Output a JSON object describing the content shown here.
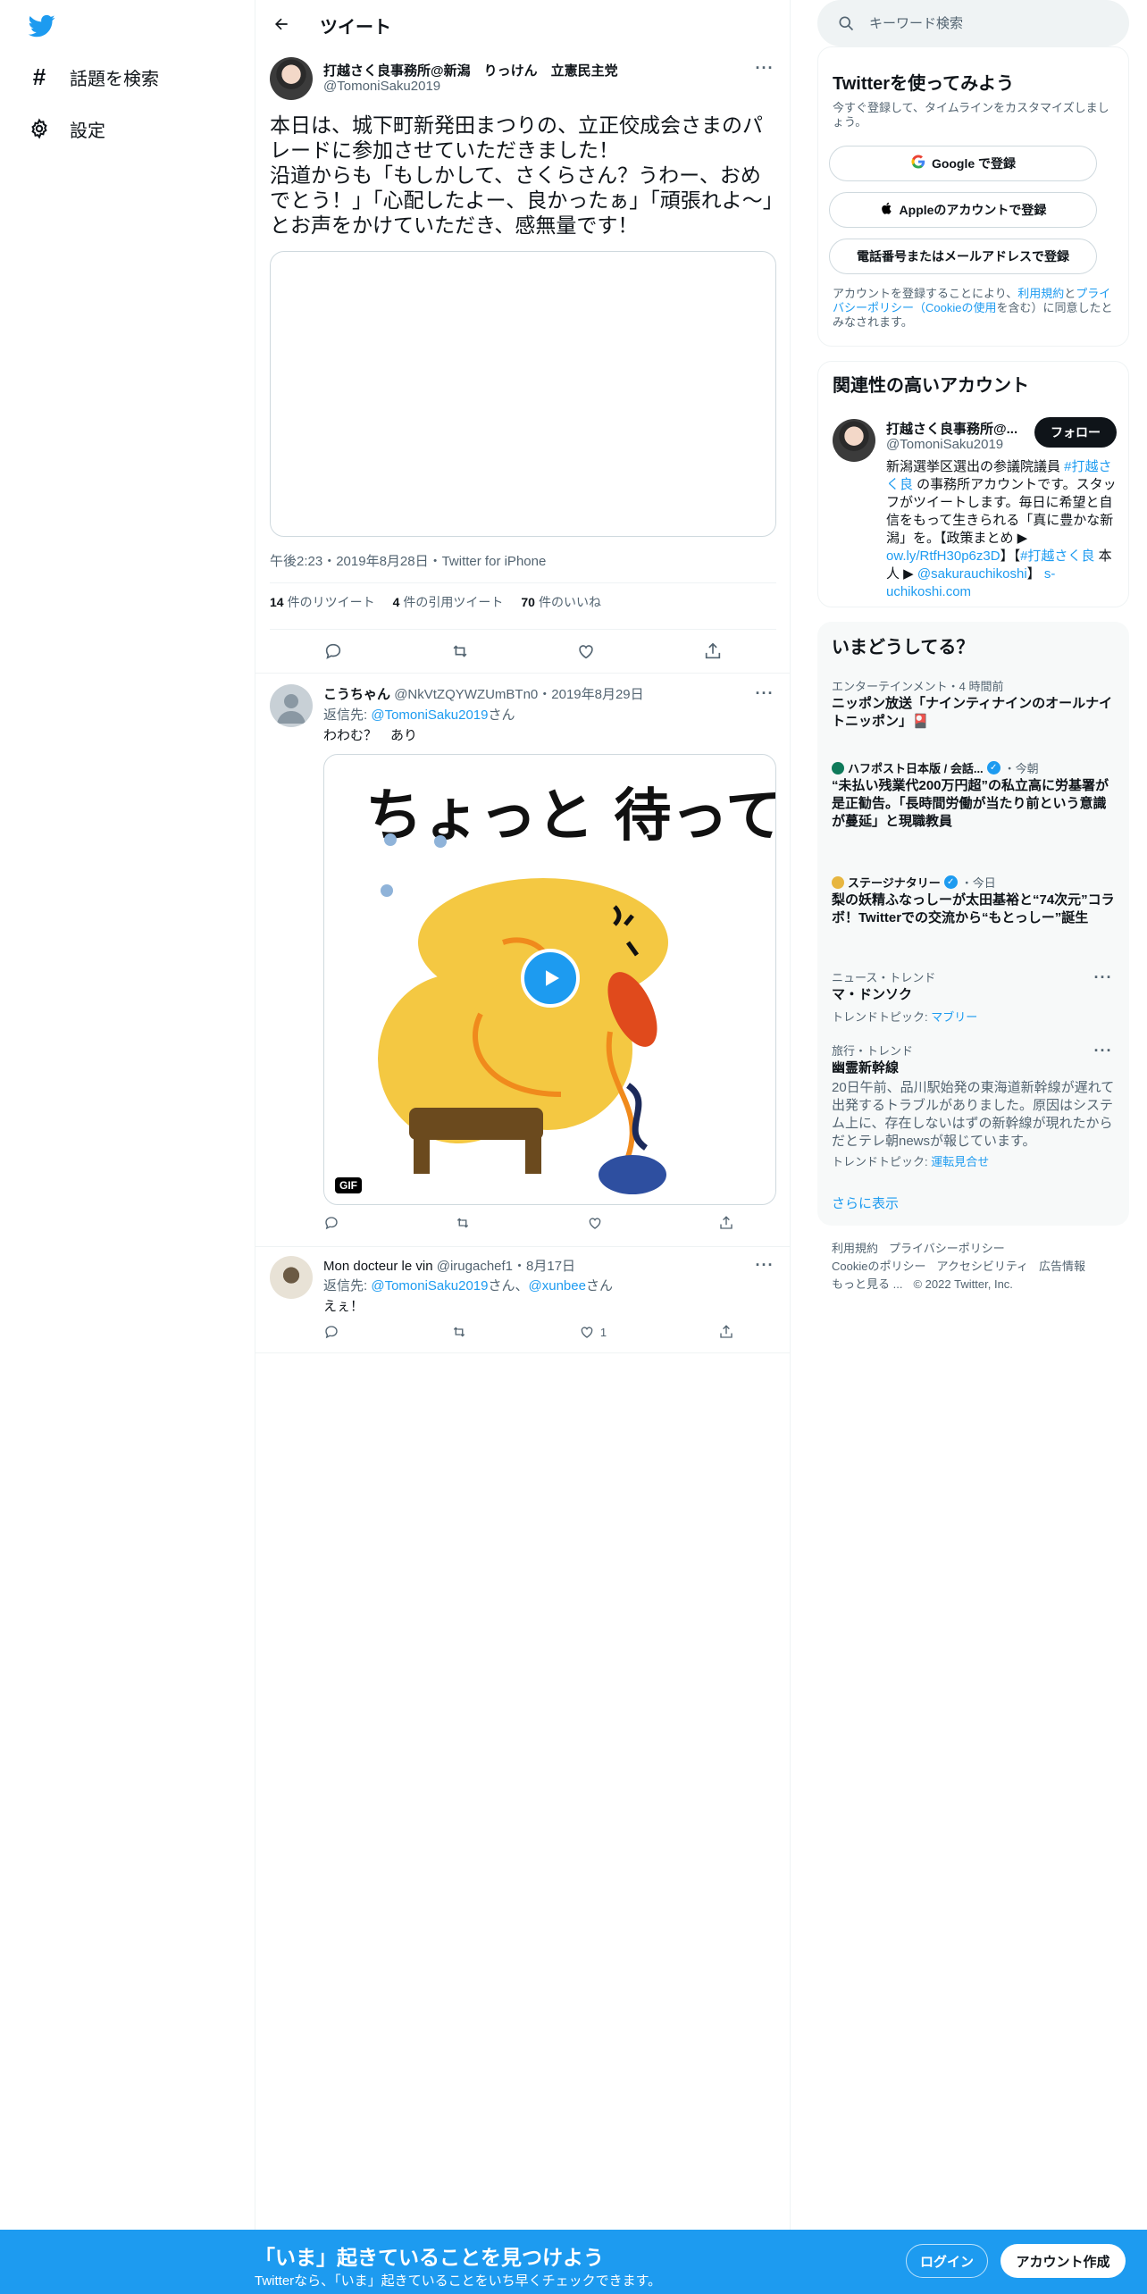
{
  "nav": {
    "items": [
      {
        "label": "話題を検索",
        "icon": "hashtag-icon"
      },
      {
        "label": "設定",
        "icon": "gear-icon"
      }
    ]
  },
  "header": {
    "title": "ツイート"
  },
  "main_tweet": {
    "name": "打越さく良事務所@新潟　りっけん　立憲民主党",
    "handle": "@TomoniSaku2019",
    "text": "本日は、城下町新発田まつりの、立正佼成会さまのパレードに参加させていただきました！\n沿道からも「もしかして、さくらさん？うわー、おめでとう！」「心配したよー、良かったぁ」「頑張れよ〜」とお声をかけていただき、感無量です！",
    "meta": "午後2:23・2019年8月28日・Twitter for iPhone",
    "retweets_num": "14",
    "retweets_label": "件のリツイート",
    "quotes_num": "4",
    "quotes_label": "件の引用ツイート",
    "likes_num": "70",
    "likes_label": "件のいいね"
  },
  "replies": [
    {
      "name": "こうちゃん",
      "handle_date": "@NkVtZQYWZUmBTn0・2019年8月29日",
      "replyto_prefix": "返信先: ",
      "replyto_mention": "@TomoniSaku2019",
      "replyto_suffix": "さん",
      "text": "わわむ？　あり",
      "gif_label": "GIF",
      "gif_caption": "ちょっと 待って!",
      "like_count": ""
    },
    {
      "name": "Mon docteur le vin",
      "handle_date": "@irugachef1・8月17日",
      "replyto_prefix": "返信先: ",
      "replyto_mention": "@TomoniSaku2019",
      "replyto_mid": "さん、",
      "replyto_mention2": "@xunbee",
      "replyto_suffix": "さん",
      "text": "えぇ！",
      "like_count": "1"
    }
  ],
  "search": {
    "placeholder": "キーワード検索"
  },
  "signup": {
    "title": "Twitterを使ってみよう",
    "subtitle": "今すぐ登録して、タイムラインをカスタマイズしましょう。",
    "google": "Google で登録",
    "apple": "Appleのアカウントで登録",
    "phone": "電話番号またはメールアドレスで登録",
    "terms_1": "アカウントを登録することにより、",
    "terms_link1": "利用規約",
    "terms_2": "と",
    "terms_link2": "プライバシーポリシー（Cookieの使用",
    "terms_3": "を含む）に同意したとみなされます。"
  },
  "related": {
    "title": "関連性の高いアカウント",
    "name": "打越さく良事務所@...",
    "handle": "@TomoniSaku2019",
    "follow": "フォロー",
    "bio_1": "新潟選挙区選出の参議院議員 ",
    "bio_tag": "#打越さく良",
    "bio_2": " の事務所アカウントです。スタッフがツイートします。毎日に希望と自信をもって生きられる「真に豊かな新潟」を。【政策まとめ ▶ ",
    "bio_link": "ow.ly/RtfH30p6z3D",
    "bio_3": "】【",
    "bio_tag2": "#打越さく良",
    "bio_4": " 本人 ▶ ",
    "bio_mention": "@sakurauchikoshi",
    "bio_5": "】 ",
    "bio_url": "s-uchikoshi.com"
  },
  "trends": {
    "title": "いまどうしてる？",
    "items": [
      {
        "meta": "エンターテインメント・4 時間前",
        "title": "ニッポン放送「ナインティナインのオールナイトニッポン」🎴"
      },
      {
        "source": "ハフポスト日本版 / 会話...",
        "time": "・今朝",
        "title": "“未払い残業代200万円超”の私立高に労基署が是正勧告。「長時間労働が当たり前という意識が蔓延」と現職教員"
      },
      {
        "source": "ステージナタリー",
        "time": "・今日",
        "title": "梨の妖精ふなっしーが太田基裕と“74次元”コラボ！Twitterでの交流から“もとっしー”誕生"
      },
      {
        "meta": "ニュース・トレンド",
        "title": "マ・ドンソク",
        "topic_label": "トレンドトピック: ",
        "topic": "マブリー"
      },
      {
        "meta": "旅行・トレンド",
        "title": "幽霊新幹線",
        "desc": "20日午前、品川駅始発の東海道新幹線が遅れて出発するトラブルがありました。原因はシステム上に、存在しないはずの新幹線が現れたからだとテレ朝newsが報じています。",
        "topic_label": "トレンドトピック: ",
        "topic": "運転見合せ"
      }
    ],
    "show_more": "さらに表示"
  },
  "footer": {
    "links": [
      "利用規約",
      "プライバシーポリシー",
      "Cookieのポリシー",
      "アクセシビリティ",
      "広告情報",
      "もっと見る ..."
    ],
    "copyright": "© 2022 Twitter, Inc."
  },
  "bottom": {
    "title": "「いま」起きていることを見つけよう",
    "subtitle": "Twitterなら、「いま」起きていることをいち早くチェックできます。",
    "login": "ログイン",
    "signup": "アカウント作成"
  },
  "colors": {
    "accent": "#1d9bf0",
    "text": "#0f1419",
    "secondary": "#536471",
    "bottom_bar": "#1d9bf0"
  }
}
